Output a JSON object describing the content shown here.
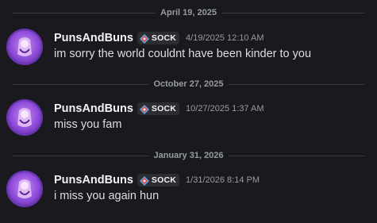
{
  "messages": [
    {
      "date_divider": "April 19, 2025",
      "username": "PunsAndBuns",
      "tag": "SOCK",
      "timestamp": "4/19/2025 12:10 AM",
      "content": "im sorry the world couldnt have been kinder to you"
    },
    {
      "date_divider": "October 27, 2025",
      "username": "PunsAndBuns",
      "tag": "SOCK",
      "timestamp": "10/27/2025 1:37 AM",
      "content": "miss you fam"
    },
    {
      "date_divider": "January 31, 2026",
      "username": "PunsAndBuns",
      "tag": "SOCK",
      "timestamp": "1/31/2026 8:14 PM",
      "content": "i miss you again hun"
    }
  ],
  "icons": {
    "avatar": "user-avatar",
    "tag_icon": "guild-tag-icon"
  },
  "colors": {
    "background": "#1a1a1e",
    "tag_icon_red": "#e84a4a",
    "tag_icon_blue": "#5aa7e6"
  }
}
